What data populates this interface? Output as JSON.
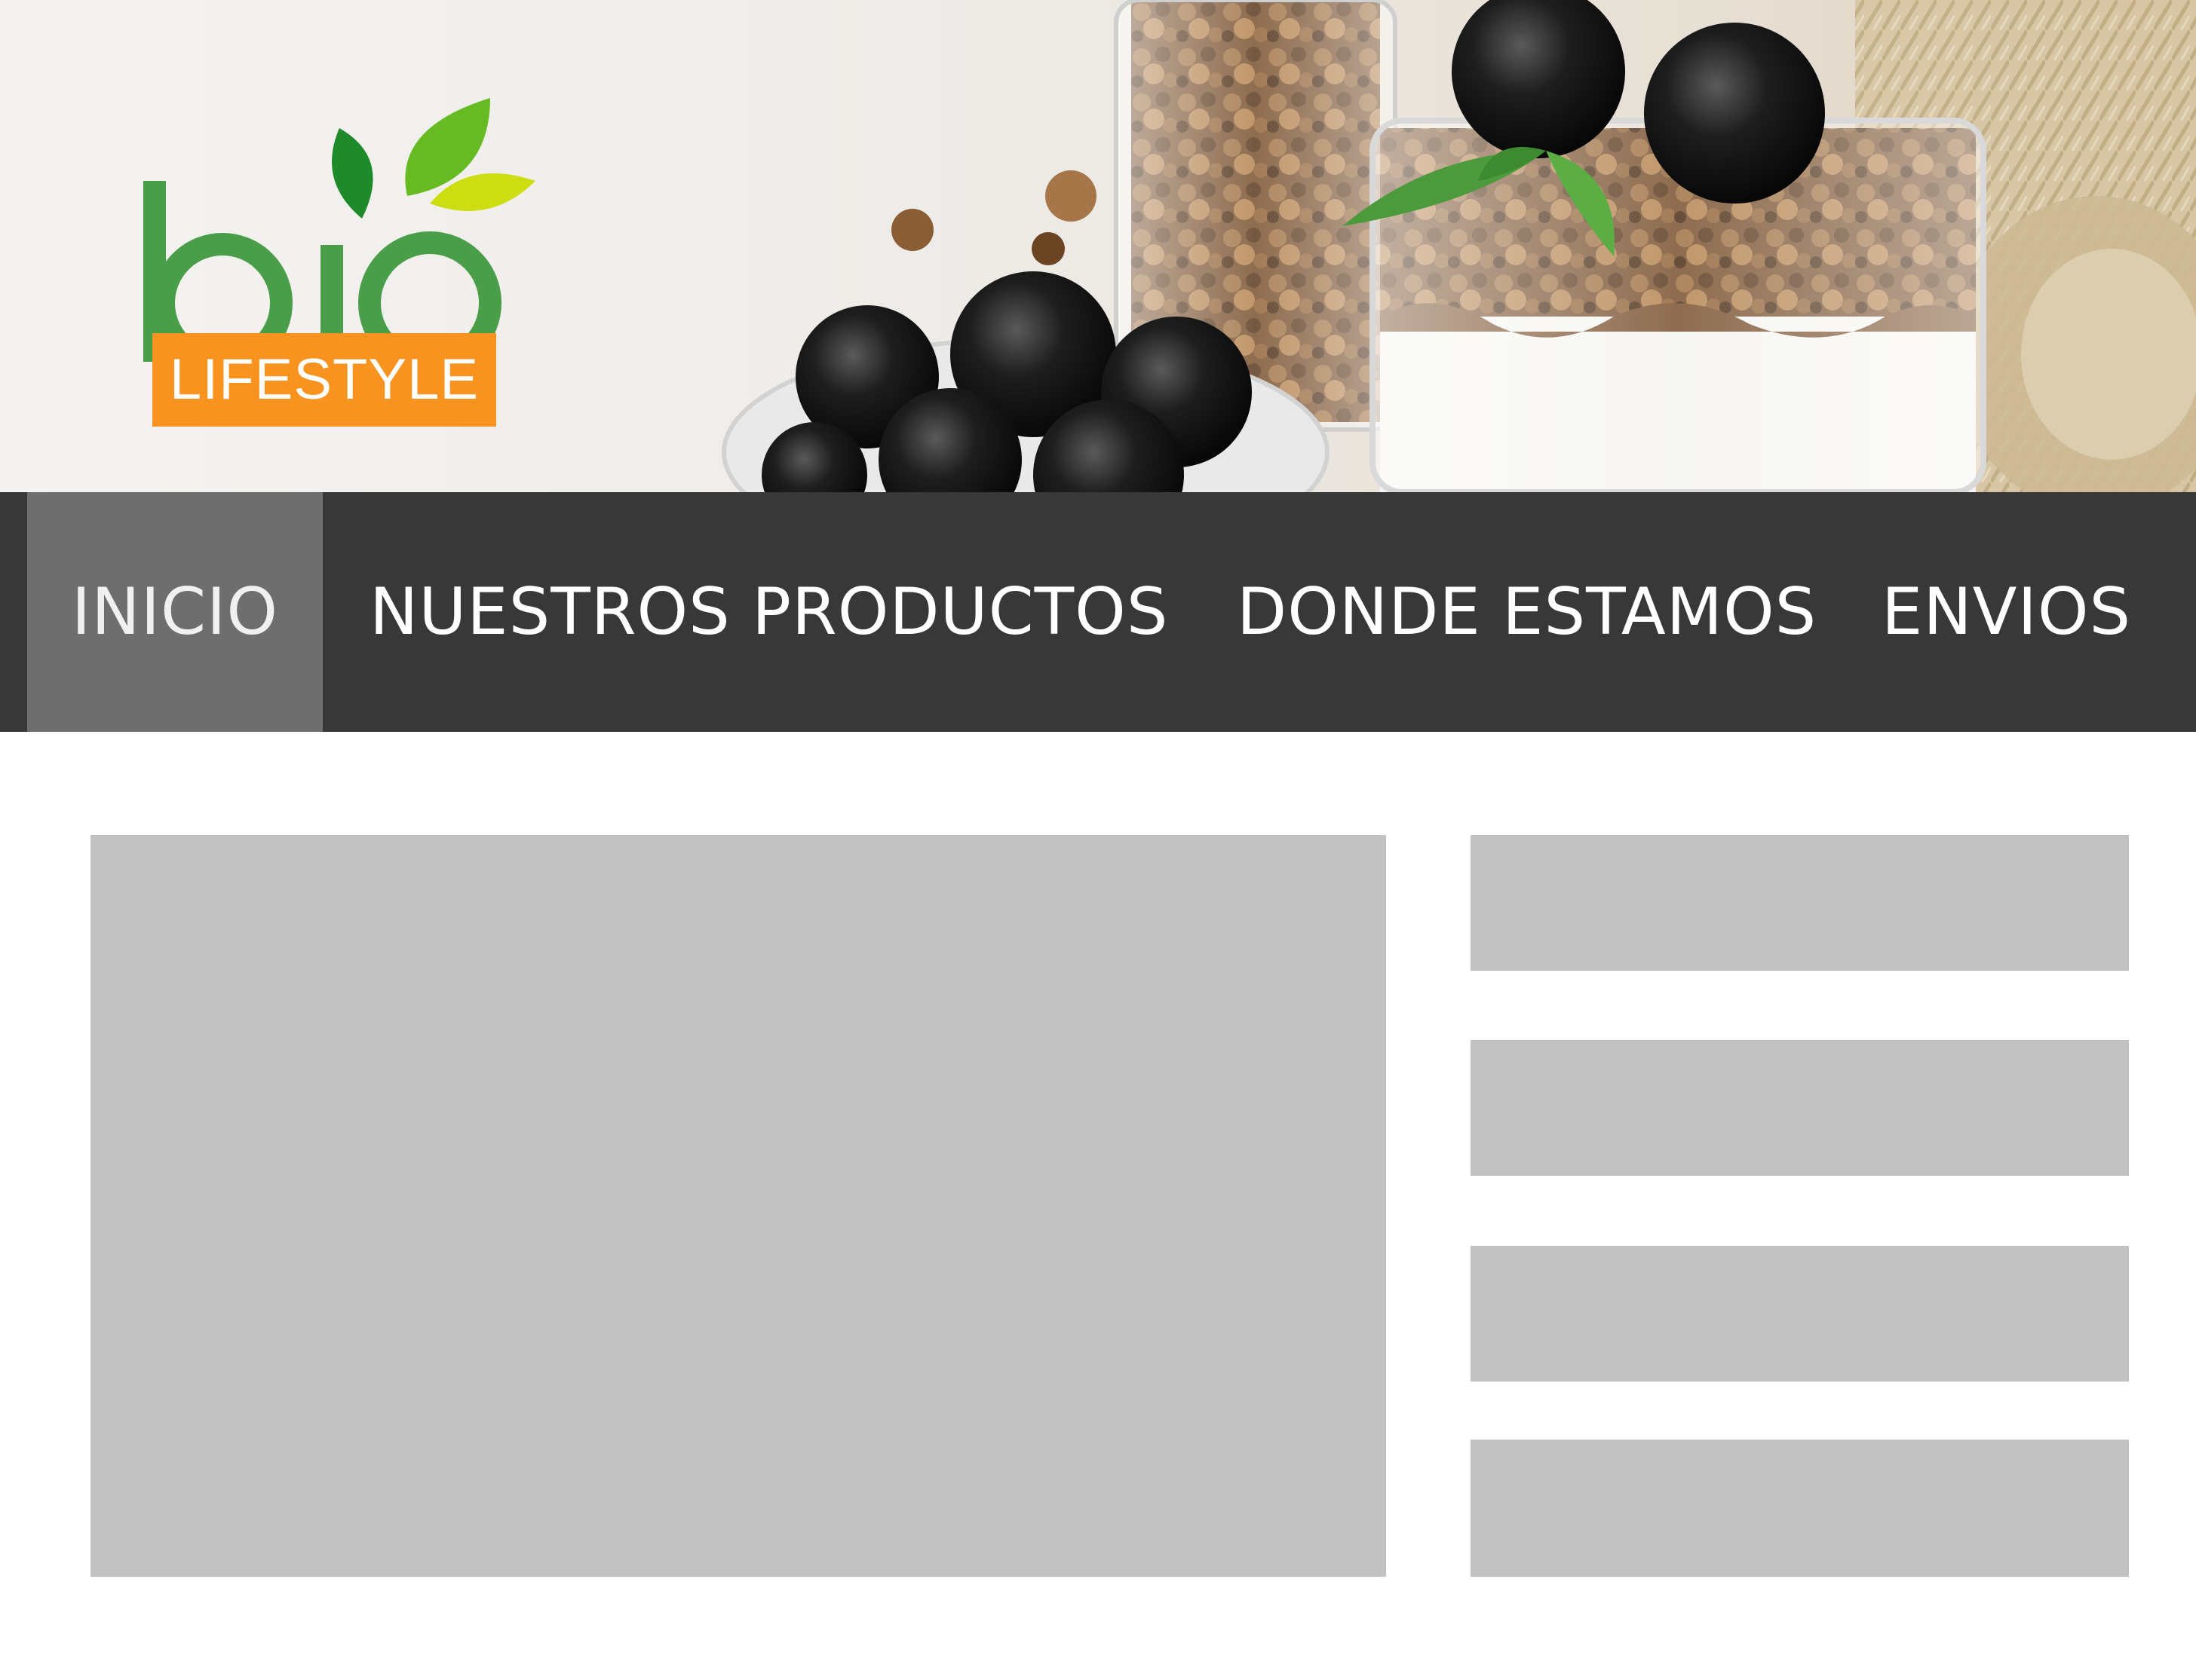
{
  "header": {
    "hero_image": "granola-yogurt-blackberries-photo",
    "logo": {
      "word": "bio",
      "tagline": "LIFESTYLE",
      "colors": {
        "word_green": "#4a9e4a",
        "leaf_dark": "#1f8a2a",
        "leaf_mid": "#66bb22",
        "leaf_light": "#ccdd11",
        "badge_orange": "#f7931e"
      }
    }
  },
  "nav": {
    "items": [
      {
        "label": "INICIO",
        "active": true
      },
      {
        "label": "NUESTROS PRODUCTOS",
        "active": false
      },
      {
        "label": "DONDE ESTAMOS",
        "active": false
      },
      {
        "label": "ENVIOS",
        "active": false
      }
    ],
    "background": "#383838",
    "active_background": "#6e6e6e"
  },
  "content": {
    "placeholder_color": "#c2c2c2"
  }
}
